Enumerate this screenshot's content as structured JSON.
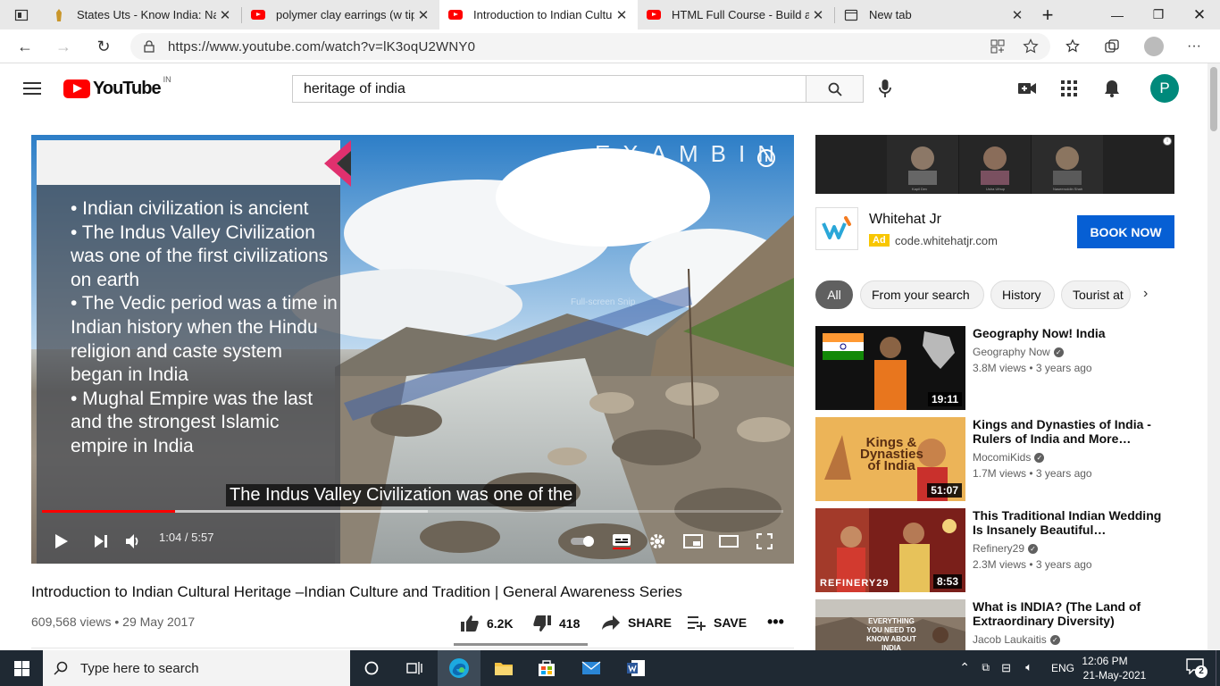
{
  "browser": {
    "tabs": [
      {
        "title": "States Uts - Know India: Natio",
        "icon": "india-emblem-icon",
        "active": false
      },
      {
        "title": "polymer clay earrings (w tips",
        "icon": "youtube-icon",
        "active": false
      },
      {
        "title": "Introduction to Indian Cultura",
        "icon": "youtube-icon",
        "active": true
      },
      {
        "title": "HTML Full Course - Build a W",
        "icon": "youtube-icon",
        "active": false
      },
      {
        "title": "New tab",
        "icon": "newtab-icon",
        "active": false
      }
    ],
    "url": "https://www.youtube.com/watch?v=lK3oqU2WNY0"
  },
  "youtube": {
    "logo_text": "YouTube",
    "region": "IN",
    "search_value": "heritage of india",
    "avatar_letter": "P"
  },
  "video": {
    "brand": "EXAMBIN",
    "slide_text": "• Indian civilization is ancient\n• The Indus Valley Civilization was one of the first civilizations on earth\n• The Vedic period was a time in Indian history when the Hindu religion and caste system began in India\n• Mughal Empire was the last and the strongest Islamic empire in India",
    "caption": "The Indus Valley Civilization was one of the",
    "watermark": "Full-screen Snip",
    "time": "1:04 / 5:57",
    "played_fraction": 0.18,
    "buffered_fraction": 0.52,
    "title": "Introduction to Indian Cultural Heritage –Indian Culture and Tradition | General Awareness Series",
    "views_date": "609,568 views • 29 May 2017",
    "likes": "6.2K",
    "dislikes": "418",
    "share_label": "SHARE",
    "save_label": "SAVE",
    "like_fraction": 0.94
  },
  "ad": {
    "name": "Whitehat Jr",
    "badge": "Ad",
    "url": "code.whitehatjr.com",
    "button": "BOOK NOW",
    "banner_captions": [
      "Kapil Dev",
      "Usha Uthup",
      "Naseeruddin Shah"
    ]
  },
  "chips": [
    "All",
    "From your search",
    "History",
    "Tourist at"
  ],
  "recommendations": [
    {
      "title": "Geography Now! India",
      "channel": "Geography Now",
      "meta": "3.8M views • 3 years ago",
      "duration": "19:11"
    },
    {
      "title": "Kings and Dynasties of India - Rulers of India and More…",
      "channel": "MocomiKids",
      "meta": "1.7M views • 3 years ago",
      "duration": "51:07",
      "thumb_text": "Kings & Dynasties of India"
    },
    {
      "title": "This Traditional Indian Wedding Is Insanely Beautiful…",
      "channel": "Refinery29",
      "meta": "2.3M views • 3 years ago",
      "duration": "8:53",
      "thumb_text": "REFINERY29"
    },
    {
      "title": "What is INDIA? (The Land of Extraordinary Diversity)",
      "channel": "Jacob Laukaitis",
      "meta": "",
      "duration": "",
      "thumb_text": "EVERYTHING YOU NEED TO KNOW ABOUT INDIA"
    }
  ],
  "taskbar": {
    "search_placeholder": "Type here to search",
    "lang": "ENG",
    "time": "12:06 PM",
    "date": "21-May-2021",
    "notifications": "2"
  },
  "colors": {
    "accent": "#ff0000",
    "blue": "#065fd4",
    "taskbar": "#1f2933"
  }
}
